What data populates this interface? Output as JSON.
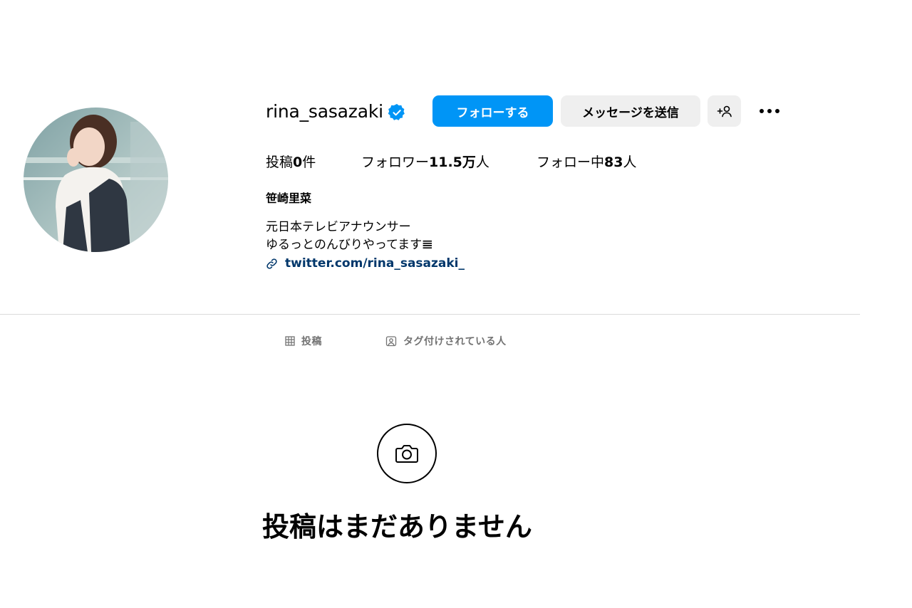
{
  "profile": {
    "username": "rina_sasazaki",
    "verified": true,
    "full_name": "笹崎里菜",
    "bio_lines": [
      "元日本テレビアナウンサー",
      "ゆるっとのんびりやってます"
    ],
    "bio_emoji": "𝌆",
    "link": "twitter.com/rina_sasazaki_"
  },
  "actions": {
    "follow_label": "フォローする",
    "message_label": "メッセージを送信",
    "suggest_icon": "add-person-icon",
    "more_icon": "more-options-icon"
  },
  "stats": {
    "posts_label": "投稿",
    "posts_count": "0",
    "posts_suffix": "件",
    "followers_label": "フォロワー",
    "followers_count": "11.5万",
    "followers_suffix": "人",
    "following_label": "フォロー中",
    "following_count": "83",
    "following_suffix": "人"
  },
  "tabs": [
    {
      "label": "投稿",
      "icon": "grid-icon",
      "active": false
    },
    {
      "label": "タグ付けされている人",
      "icon": "tagged-icon",
      "active": false
    }
  ],
  "empty_state": {
    "icon": "camera-icon",
    "text": "投稿はまだありません"
  },
  "colors": {
    "primary": "#0095f6",
    "secondary_button": "#efefef",
    "link": "#00376b",
    "muted": "#737373",
    "divider": "#dbdbdb"
  }
}
